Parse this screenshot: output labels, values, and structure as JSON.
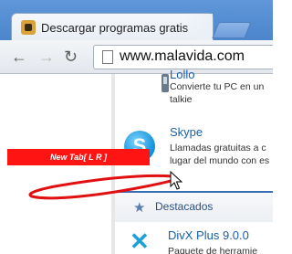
{
  "browser": {
    "tab_title": "Descargar programas gratis",
    "url": "www.malavida.com"
  },
  "overlay": {
    "tab_label": "New Tab[ L R ]"
  },
  "page": {
    "items": [
      {
        "title_partial": "Lollo",
        "desc_lines": [
          "Convierte tu PC en un",
          "talkie"
        ]
      },
      {
        "title": "Skype",
        "desc_lines": [
          "Llamadas gratuitas a c",
          "lugar del mundo con es"
        ]
      }
    ],
    "featured_label": "Destacados",
    "next_item": {
      "title": "DivX Plus 9.0.0",
      "desc": "Paquete de herramie"
    }
  },
  "colors": {
    "tab_strip": "#4c85cc",
    "red_label_bg": "#ff1414",
    "link_blue": "#1b5fa8",
    "featured_border": "#3b6db3"
  }
}
